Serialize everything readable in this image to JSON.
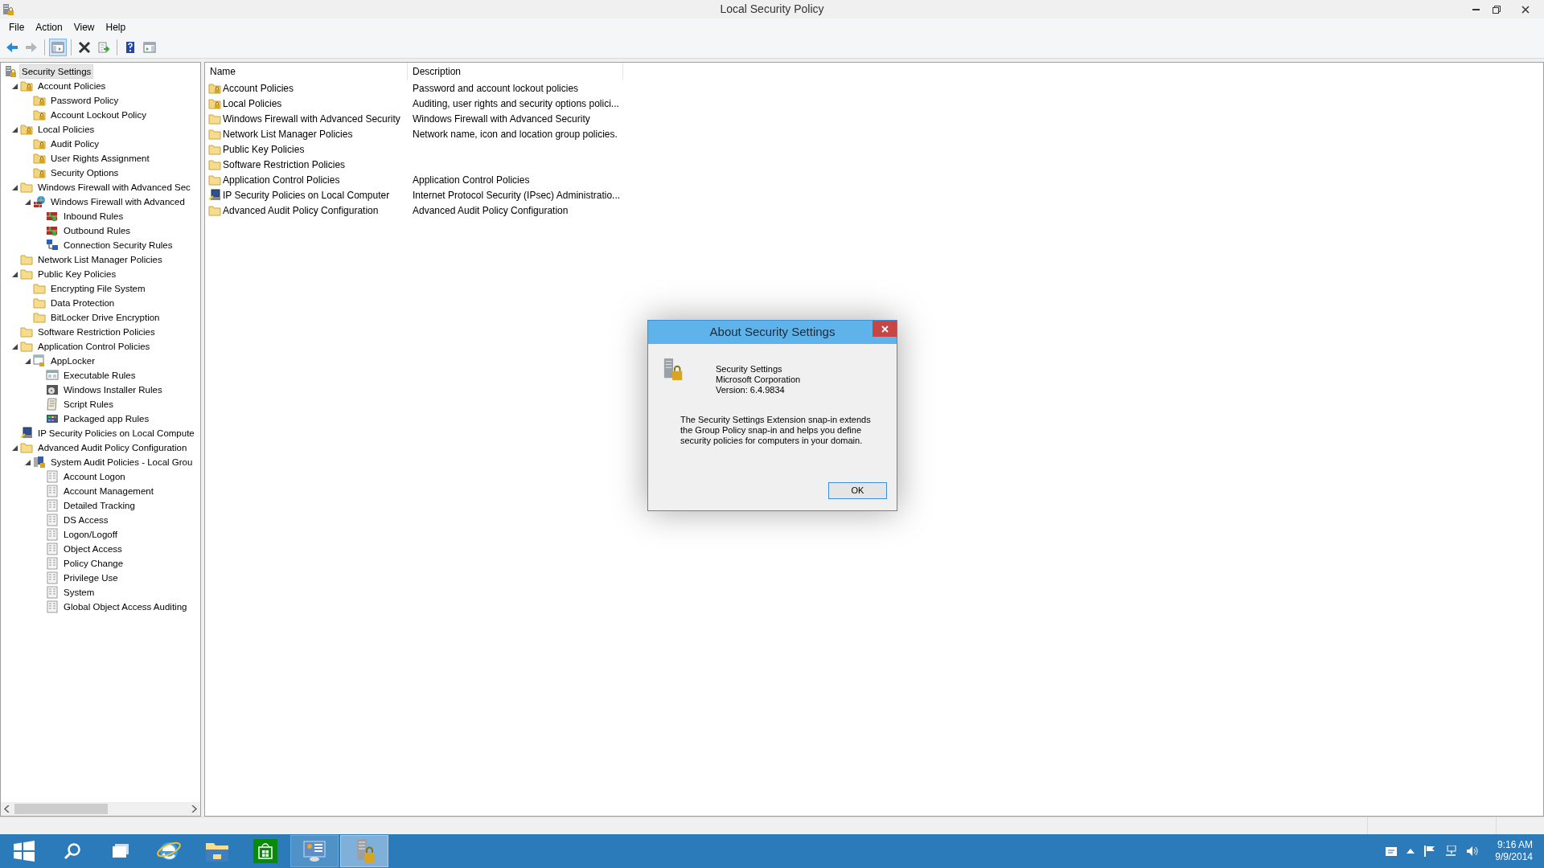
{
  "window": {
    "title": "Local Security Policy"
  },
  "menu": [
    {
      "label": "File"
    },
    {
      "label": "Action"
    },
    {
      "label": "View"
    },
    {
      "label": "Help"
    }
  ],
  "toolbar": [
    [
      {
        "kind": "back",
        "disabled": false,
        "pressed": false
      },
      {
        "kind": "forward",
        "disabled": true,
        "pressed": false
      }
    ],
    [
      {
        "kind": "console-tree",
        "disabled": false,
        "pressed": true
      }
    ],
    [
      {
        "kind": "delete",
        "disabled": false,
        "pressed": false
      },
      {
        "kind": "export",
        "disabled": false,
        "pressed": false
      }
    ],
    [
      {
        "kind": "help",
        "disabled": false,
        "pressed": false
      },
      {
        "kind": "action-pane",
        "disabled": false,
        "pressed": false
      }
    ]
  ],
  "tree": [
    {
      "label": "Security Settings",
      "kind": "root",
      "selected": true,
      "children": [
        {
          "label": "Account Policies",
          "kind": "lock-folder",
          "selected": false,
          "expanded": true,
          "children": [
            {
              "label": "Password Policy",
              "kind": "lock-folder",
              "selected": false
            },
            {
              "label": "Account Lockout Policy",
              "kind": "lock-folder",
              "selected": false
            }
          ]
        },
        {
          "label": "Local Policies",
          "kind": "lock-folder",
          "selected": false,
          "expanded": true,
          "children": [
            {
              "label": "Audit Policy",
              "kind": "lock-folder",
              "selected": false
            },
            {
              "label": "User Rights Assignment",
              "kind": "lock-folder",
              "selected": false
            },
            {
              "label": "Security Options",
              "kind": "lock-folder",
              "selected": false
            }
          ]
        },
        {
          "label": "Windows Firewall with Advanced Sec",
          "kind": "folder",
          "selected": false,
          "expanded": true,
          "children": [
            {
              "label": "Windows Firewall with Advanced",
              "kind": "firewall",
              "selected": false,
              "expanded": true,
              "children": [
                {
                  "label": "Inbound Rules",
                  "kind": "firewall-rule",
                  "selected": false
                },
                {
                  "label": "Outbound Rules",
                  "kind": "firewall-rule",
                  "selected": false
                },
                {
                  "label": "Connection Security Rules",
                  "kind": "connection",
                  "selected": false
                }
              ]
            }
          ]
        },
        {
          "label": "Network List Manager Policies",
          "kind": "folder",
          "selected": false
        },
        {
          "label": "Public Key Policies",
          "kind": "folder",
          "selected": false,
          "expanded": true,
          "children": [
            {
              "label": "Encrypting File System",
              "kind": "folder",
              "selected": false
            },
            {
              "label": "Data Protection",
              "kind": "folder",
              "selected": false
            },
            {
              "label": "BitLocker Drive Encryption",
              "kind": "folder",
              "selected": false
            }
          ]
        },
        {
          "label": "Software Restriction Policies",
          "kind": "folder",
          "selected": false
        },
        {
          "label": "Application Control Policies",
          "kind": "folder",
          "selected": false,
          "expanded": true,
          "children": [
            {
              "label": "AppLocker",
              "kind": "applocker",
              "selected": false,
              "expanded": true,
              "children": [
                {
                  "label": "Executable Rules",
                  "kind": "window",
                  "selected": false
                },
                {
                  "label": "Windows Installer Rules",
                  "kind": "installer",
                  "selected": false
                },
                {
                  "label": "Script Rules",
                  "kind": "script",
                  "selected": false
                },
                {
                  "label": "Packaged app Rules",
                  "kind": "package",
                  "selected": false
                }
              ]
            }
          ]
        },
        {
          "label": "IP Security Policies on Local Compute",
          "kind": "ipsec",
          "selected": false
        },
        {
          "label": "Advanced Audit Policy Configuration",
          "kind": "folder",
          "selected": false,
          "expanded": true,
          "children": [
            {
              "label": "System Audit Policies - Local Grou",
              "kind": "audit-root",
              "selected": false,
              "expanded": true,
              "children": [
                {
                  "label": "Account Logon",
                  "kind": "audit",
                  "selected": false
                },
                {
                  "label": "Account Management",
                  "kind": "audit",
                  "selected": false
                },
                {
                  "label": "Detailed Tracking",
                  "kind": "audit",
                  "selected": false
                },
                {
                  "label": "DS Access",
                  "kind": "audit",
                  "selected": false
                },
                {
                  "label": "Logon/Logoff",
                  "kind": "audit",
                  "selected": false
                },
                {
                  "label": "Object Access",
                  "kind": "audit",
                  "selected": false
                },
                {
                  "label": "Policy Change",
                  "kind": "audit",
                  "selected": false
                },
                {
                  "label": "Privilege Use",
                  "kind": "audit",
                  "selected": false
                },
                {
                  "label": "System",
                  "kind": "audit",
                  "selected": false
                },
                {
                  "label": "Global Object Access Auditing",
                  "kind": "audit",
                  "selected": false
                }
              ]
            }
          ]
        }
      ]
    }
  ],
  "table": {
    "columns": [
      "Name",
      "Description"
    ],
    "rows": [
      {
        "kind": "lock-folder",
        "name": "Account Policies",
        "description": "Password and account lockout policies"
      },
      {
        "kind": "lock-folder",
        "name": "Local Policies",
        "description": "Auditing, user rights and security options polici..."
      },
      {
        "kind": "folder",
        "name": "Windows Firewall with Advanced Security",
        "description": "Windows Firewall with Advanced Security"
      },
      {
        "kind": "folder",
        "name": "Network List Manager Policies",
        "description": "Network name, icon and location group policies."
      },
      {
        "kind": "folder",
        "name": "Public Key Policies"
      },
      {
        "kind": "folder",
        "name": "Software Restriction Policies"
      },
      {
        "kind": "folder",
        "name": "Application Control Policies",
        "description": "Application Control Policies"
      },
      {
        "kind": "ipsec",
        "name": "IP Security Policies on Local Computer",
        "description": "Internet Protocol Security (IPsec) Administratio..."
      },
      {
        "kind": "folder",
        "name": "Advanced Audit Policy Configuration",
        "description": "Advanced Audit Policy Configuration"
      }
    ]
  },
  "dialog": {
    "title": "About Security Settings",
    "product": "Security Settings",
    "company": "Microsoft Corporation",
    "version": "Version: 6.4.9834",
    "description": "The Security Settings Extension snap-in extends the Group Policy snap-in and helps you define security policies for computers in your domain.",
    "button": "OK"
  },
  "taskbar": {
    "apps": [
      {
        "kind": "start",
        "selected": false
      },
      {
        "kind": "search",
        "selected": false
      },
      {
        "kind": "task-view",
        "selected": false
      },
      {
        "kind": "browser",
        "selected": false
      },
      {
        "kind": "explorer",
        "selected": false
      },
      {
        "kind": "store",
        "selected": false
      },
      {
        "kind": "control-panel",
        "selected": false
      },
      {
        "kind": "security-policy",
        "selected": true
      }
    ],
    "tray": [
      {
        "kind": "message"
      },
      {
        "kind": "up"
      },
      {
        "kind": "flag"
      },
      {
        "kind": "network"
      },
      {
        "kind": "volume"
      }
    ],
    "time": "9:16 AM",
    "date": "9/9/2014"
  }
}
